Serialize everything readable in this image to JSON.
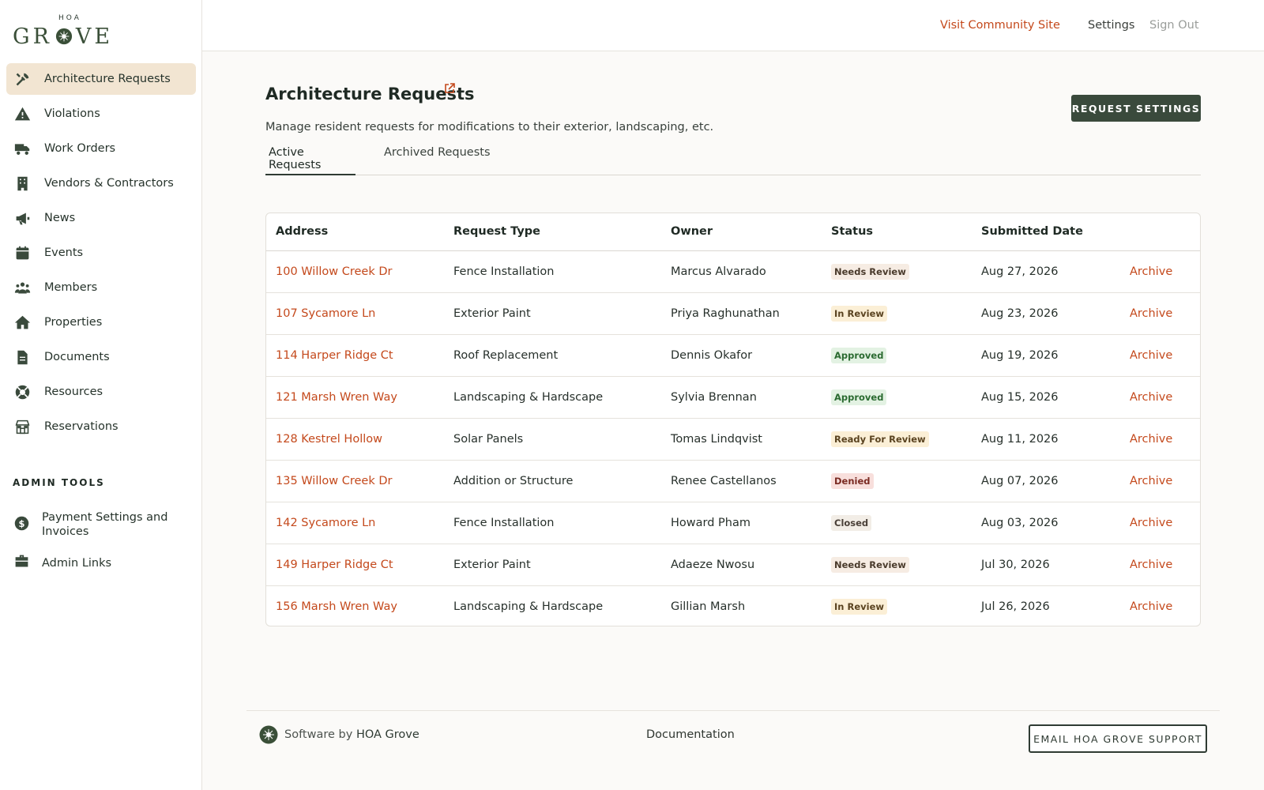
{
  "logo": {
    "top_text": "HOA",
    "word_left": "GR",
    "word_right": "VE"
  },
  "sidebar": {
    "items": [
      {
        "label": "Architecture Requests",
        "icon": "tools-icon",
        "active": true
      },
      {
        "label": "Violations",
        "icon": "warning-icon"
      },
      {
        "label": "Work Orders",
        "icon": "truck-icon"
      },
      {
        "label": "Vendors & Contractors",
        "icon": "building-icon"
      },
      {
        "label": "News",
        "icon": "megaphone-icon"
      },
      {
        "label": "Events",
        "icon": "calendar-icon"
      },
      {
        "label": "Members",
        "icon": "users-icon"
      },
      {
        "label": "Properties",
        "icon": "home-icon"
      },
      {
        "label": "Documents",
        "icon": "document-icon"
      },
      {
        "label": "Resources",
        "icon": "lifebuoy-icon"
      },
      {
        "label": "Reservations",
        "icon": "storefront-icon"
      }
    ],
    "admin_heading": "ADMIN TOOLS",
    "admin_items": [
      {
        "label": "Payment Settings and Invoices",
        "icon": "dollar-icon"
      },
      {
        "label": "Admin Links",
        "icon": "briefcase-icon"
      }
    ]
  },
  "topbar": {
    "visit_link": "Visit Community Site",
    "settings_link": "Settings",
    "signout_link": "Sign Out"
  },
  "page": {
    "title": "Architecture Requests",
    "description": "Manage resident requests for modifications to their exterior, landscaping, etc.",
    "settings_button": "REQUEST SETTINGS",
    "tabs": [
      {
        "label": "Active Requests",
        "active": true
      },
      {
        "label": "Archived Requests",
        "active": false
      }
    ]
  },
  "table": {
    "columns": [
      "Address",
      "Request Type",
      "Owner",
      "Status",
      "Submitted Date",
      ""
    ],
    "rows": [
      {
        "address": "100 Willow Creek Dr",
        "type": "Fence Installation",
        "owner": "Marcus Alvarado",
        "status": "Needs Review",
        "date": "Aug 27, 2026",
        "action": "Archive"
      },
      {
        "address": "107 Sycamore Ln",
        "type": "Exterior Paint",
        "owner": "Priya Raghunathan",
        "status": "In Review",
        "date": "Aug 23, 2026",
        "action": "Archive"
      },
      {
        "address": "114 Harper Ridge Ct",
        "type": "Roof Replacement",
        "owner": "Dennis Okafor",
        "status": "Approved",
        "date": "Aug 19, 2026",
        "action": "Archive"
      },
      {
        "address": "121 Marsh Wren Way",
        "type": "Landscaping & Hardscape",
        "owner": "Sylvia Brennan",
        "status": "Approved",
        "date": "Aug 15, 2026",
        "action": "Archive"
      },
      {
        "address": "128 Kestrel Hollow",
        "type": "Solar Panels",
        "owner": "Tomas Lindqvist",
        "status": "Ready For Review",
        "date": "Aug 11, 2026",
        "action": "Archive"
      },
      {
        "address": "135 Willow Creek Dr",
        "type": "Addition or Structure",
        "owner": "Renee Castellanos",
        "status": "Denied",
        "date": "Aug 07, 2026",
        "action": "Archive"
      },
      {
        "address": "142 Sycamore Ln",
        "type": "Fence Installation",
        "owner": "Howard Pham",
        "status": "Closed",
        "date": "Aug 03, 2026",
        "action": "Archive"
      },
      {
        "address": "149 Harper Ridge Ct",
        "type": "Exterior Paint",
        "owner": "Adaeze Nwosu",
        "status": "Needs Review",
        "date": "Jul 30, 2026",
        "action": "Archive"
      },
      {
        "address": "156 Marsh Wren Way",
        "type": "Landscaping & Hardscape",
        "owner": "Gillian Marsh",
        "status": "In Review",
        "date": "Jul 26, 2026",
        "action": "Archive"
      }
    ]
  },
  "footer": {
    "software_by": "Software by",
    "brand": "HOA Grove",
    "documentation": "Documentation",
    "email_button": "EMAIL HOA GROVE SUPPORT"
  },
  "colors": {
    "accent": "#c4491c",
    "brand_dark": "#3a4a3c",
    "active_nav_bg": "#f2e5d2"
  }
}
